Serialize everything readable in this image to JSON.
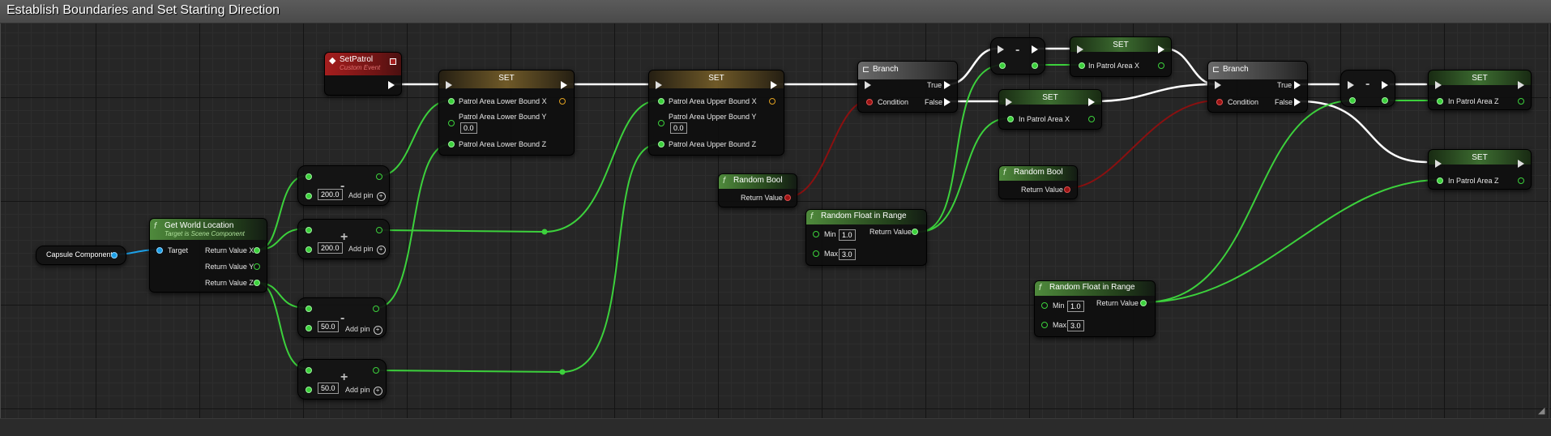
{
  "comment_title": "Establish Boundaries and Set Starting Direction",
  "nodes": {
    "set_patrol": {
      "title": "SetPatrol",
      "subtitle": "Custom Event"
    },
    "capsule": {
      "label": "Capsule Component"
    },
    "get_world_location": {
      "title": "Get World Location",
      "subtitle": "Target is Scene Component",
      "target": "Target",
      "ret_x": "Return Value X",
      "ret_y": "Return Value Y",
      "ret_z": "Return Value Z"
    },
    "math1": {
      "op": "-",
      "value": "200.0",
      "add_pin": "Add pin"
    },
    "math2": {
      "op": "+",
      "value": "200.0",
      "add_pin": "Add pin"
    },
    "math3": {
      "op": "-",
      "value": "50.0",
      "add_pin": "Add pin"
    },
    "math4": {
      "op": "+",
      "value": "50.0",
      "add_pin": "Add pin"
    },
    "set_lower": {
      "title": "SET",
      "x": "Patrol Area Lower Bound X",
      "y": "Patrol Area Lower Bound Y",
      "y_value": "0.0",
      "z": "Patrol Area Lower Bound Z"
    },
    "set_upper": {
      "title": "SET",
      "x": "Patrol Area Upper Bound X",
      "y": "Patrol Area Upper Bound Y",
      "y_value": "0.0",
      "z": "Patrol Area Upper Bound Z"
    },
    "random_bool_1": {
      "title": "Random Bool",
      "ret": "Return Value"
    },
    "random_bool_2": {
      "title": "Random Bool",
      "ret": "Return Value"
    },
    "branch1": {
      "title": "Branch",
      "true": "True",
      "false": "False",
      "cond": "Condition"
    },
    "branch2": {
      "title": "Branch",
      "true": "True",
      "false": "False",
      "cond": "Condition"
    },
    "rand_float_1": {
      "title": "Random Float in Range",
      "min": "Min",
      "min_val": "1.0",
      "max": "Max",
      "max_val": "3.0",
      "ret": "Return Value"
    },
    "rand_float_2": {
      "title": "Random Float in Range",
      "min": "Min",
      "min_val": "1.0",
      "max": "Max",
      "max_val": "3.0",
      "ret": "Return Value"
    },
    "neg1": {
      "op": "-"
    },
    "neg2": {
      "op": "-"
    },
    "set_x_true": {
      "title": "SET",
      "pin": "In Patrol Area X"
    },
    "set_x_false": {
      "title": "SET",
      "pin": "In Patrol Area X"
    },
    "set_z_true": {
      "title": "SET",
      "pin": "In Patrol Area Z"
    },
    "set_z_false": {
      "title": "SET",
      "pin": "In Patrol Area Z"
    }
  },
  "colors": {
    "exec_wire": "#ffffff",
    "float_wire": "#3cd13c",
    "object_wire": "#1ca0e8",
    "bool_wire": "#8a1010"
  }
}
